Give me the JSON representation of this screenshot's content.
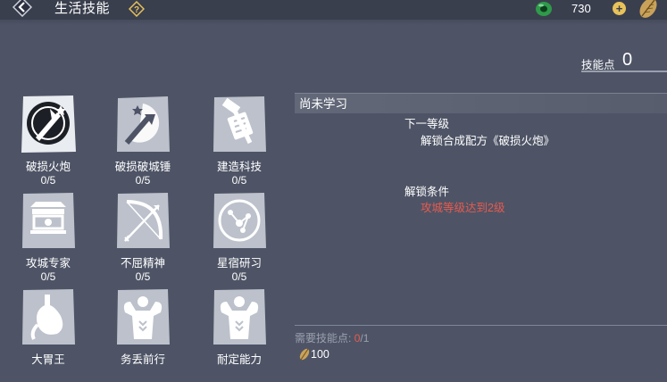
{
  "header": {
    "title": "生活技能",
    "currency_value": "730"
  },
  "skill_points": {
    "label": "技能点",
    "value": "0"
  },
  "skills": [
    {
      "name": "破损火炮",
      "level": "0/5"
    },
    {
      "name": "破损破城锤",
      "level": "0/5"
    },
    {
      "name": "建造科技",
      "level": "0/5"
    },
    {
      "name": "攻城专家",
      "level": "0/5"
    },
    {
      "name": "不屈精神",
      "level": "0/5"
    },
    {
      "name": "星宿研习",
      "level": "0/5"
    },
    {
      "name": "大胃王",
      "level": ""
    },
    {
      "name": "务丢前行",
      "level": ""
    },
    {
      "name": "耐定能力",
      "level": ""
    }
  ],
  "panel": {
    "status": "尚未学习",
    "next_level_label": "下一等级",
    "next_level_value": "解锁合成配方《破损火炮》",
    "unlock_label": "解锁条件",
    "unlock_value": "攻城等级达到2级",
    "required_label": "需要技能点:",
    "required_current": "0",
    "required_total": "/1",
    "cost": "100"
  },
  "colors": {
    "background": "#4e5466",
    "topbar": "#3a3f4e",
    "warning": "#e85a4e",
    "gold": "#e8c25a"
  },
  "icons": [
    "back-icon",
    "help-icon",
    "jade-currency-icon",
    "plus-icon",
    "leaf-currency-icon",
    "cannon-icon",
    "ram-icon",
    "hammer-icon",
    "building-icon",
    "bow-icon",
    "star-icon",
    "stomach-icon",
    "muscle-icon"
  ]
}
